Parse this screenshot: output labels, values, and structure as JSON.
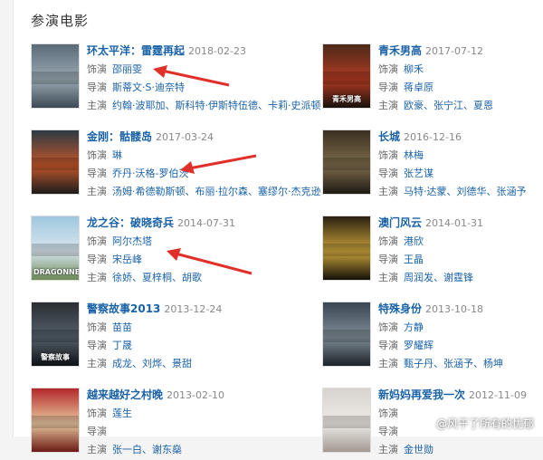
{
  "section": {
    "title": "参演电影"
  },
  "labels": {
    "role": "饰演",
    "director": "导演",
    "cast": "主演"
  },
  "films": [
    {
      "title": "环太平洋：雷霆再起",
      "date": "2018-02-23",
      "role": "邵丽雯",
      "director": "斯蒂文·S·迪奈特",
      "cast": "约翰·波耶加、斯科特·伊斯特伍德、卡莉·史派顿",
      "poster_text": "",
      "poster_colors": [
        "#5a6b78",
        "#9aa9b3",
        "#3d4a55"
      ]
    },
    {
      "title": "青禾男高",
      "date": "2017-07-12",
      "role": "柳禾",
      "director": "蒋卓原",
      "cast": "欧豪、张宁江、夏恩",
      "poster_text": "青禾男高",
      "poster_colors": [
        "#4a2a1a",
        "#b23a22",
        "#1a120c"
      ]
    },
    {
      "title": "金刚：骷髅岛",
      "date": "2017-03-24",
      "role": "琳",
      "director": "乔丹·沃格-罗伯茨",
      "cast": "汤姆·希德勒斯顿、布丽·拉尔森、塞缪尔·杰克逊",
      "poster_text": "",
      "poster_colors": [
        "#2b3a44",
        "#c2562a",
        "#1c1c1c"
      ]
    },
    {
      "title": "长城",
      "date": "2016-12-16",
      "role": "林梅",
      "director": "张艺谋",
      "cast": "马特·达蒙、刘德华、张涵予",
      "poster_text": "",
      "poster_colors": [
        "#3a3022",
        "#7c6a4a",
        "#1e1a14"
      ]
    },
    {
      "title": "龙之谷：破晓奇兵",
      "date": "2014-07-31",
      "role": "阿尔杰塔",
      "director": "宋岳峰",
      "cast": "徐娇、夏梓桐、胡歌",
      "poster_text": "DRAGONNEST",
      "poster_colors": [
        "#9fc7de",
        "#d8e6ee",
        "#6b8a58"
      ]
    },
    {
      "title": "澳门风云",
      "date": "2014-01-31",
      "role": "港欣",
      "director": "王晶",
      "cast": "周润发、谢霆锋",
      "poster_text": "",
      "poster_colors": [
        "#2a2010",
        "#c9a23a",
        "#141008"
      ]
    },
    {
      "title": "警察故事2013",
      "date": "2013-12-24",
      "role": "苗苗",
      "director": "丁晟",
      "cast": "成龙、刘烨、景甜",
      "poster_text": "警察故事",
      "poster_colors": [
        "#2a2e33",
        "#54606a",
        "#0f1114"
      ]
    },
    {
      "title": "特殊身份",
      "date": "2013-10-18",
      "role": "方静",
      "director": "罗耀辉",
      "cast": "甄子丹、张涵予、杨坤",
      "poster_text": "",
      "poster_colors": [
        "#3a4752",
        "#7f8c96",
        "#1b2228"
      ]
    },
    {
      "title": "越来越好之村晚",
      "date": "2013-02-10",
      "role": "莲生",
      "director": "",
      "cast": "张一白、谢东燊",
      "poster_text": "",
      "poster_colors": [
        "#b3282a",
        "#e9c8a0",
        "#6a1a14"
      ]
    },
    {
      "title": "新妈妈再爱我一次",
      "date": "2012-11-09",
      "role": "",
      "director": "",
      "cast": "金世勋",
      "poster_text": "",
      "poster_colors": [
        "#d7d2cc",
        "#efebe6",
        "#a29a92"
      ]
    }
  ],
  "watermark": "@风干了所有的忧郁",
  "accent_color": "#1a62a8",
  "arrow_color": "#e0302a"
}
